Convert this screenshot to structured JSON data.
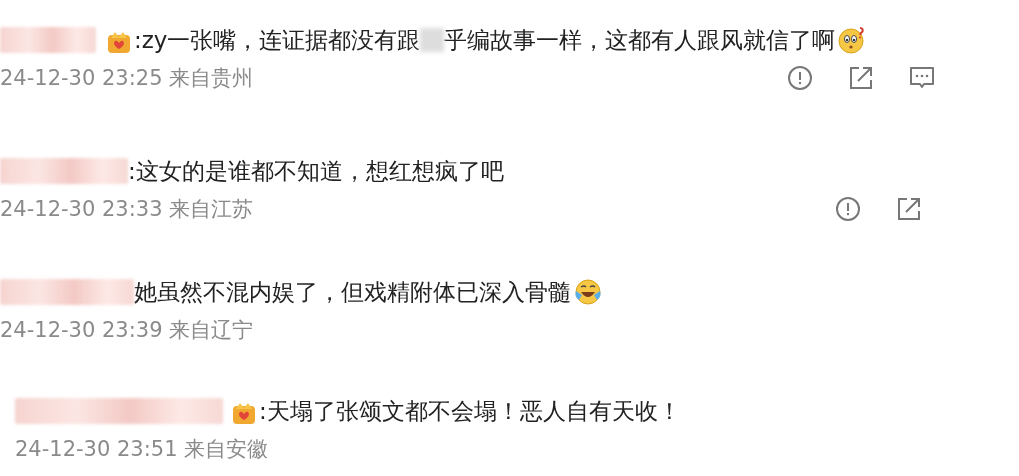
{
  "comments": [
    {
      "segments": [
        {
          "kind": "name"
        },
        {
          "kind": "badge"
        },
        {
          "kind": "text",
          "text": ":zy一张嘴，连证据都没有跟"
        },
        {
          "kind": "blur"
        },
        {
          "kind": "text",
          "text": "乎编故事一样，这都有人跟风就信了啊"
        },
        {
          "kind": "emoji-puzzled"
        }
      ],
      "meta": "24-12-30 23:25 来自贵州",
      "actions": [
        {
          "kind": "report"
        },
        {
          "kind": "share"
        },
        {
          "kind": "comment"
        }
      ]
    },
    {
      "segments": [
        {
          "kind": "name"
        },
        {
          "kind": "text",
          "text": ":这女的是谁都不知道，想红想疯了吧"
        }
      ],
      "meta": "24-12-30 23:33 来自江苏",
      "actions": [
        {
          "kind": "report"
        },
        {
          "kind": "share"
        }
      ]
    },
    {
      "segments": [
        {
          "kind": "name"
        },
        {
          "kind": "text",
          "text": "她虽然不混内娱了，但戏精附体已深入骨髓"
        },
        {
          "kind": "emoji-laughing"
        }
      ],
      "meta": "24-12-30 23:39 来自辽宁"
    },
    {
      "segments": [
        {
          "kind": "name"
        },
        {
          "kind": "badge"
        },
        {
          "kind": "text",
          "text": ":天塌了张颂文都不会塌！恶人自有天收！"
        }
      ],
      "meta": "24-12-30 23:51 来自安徽"
    }
  ]
}
